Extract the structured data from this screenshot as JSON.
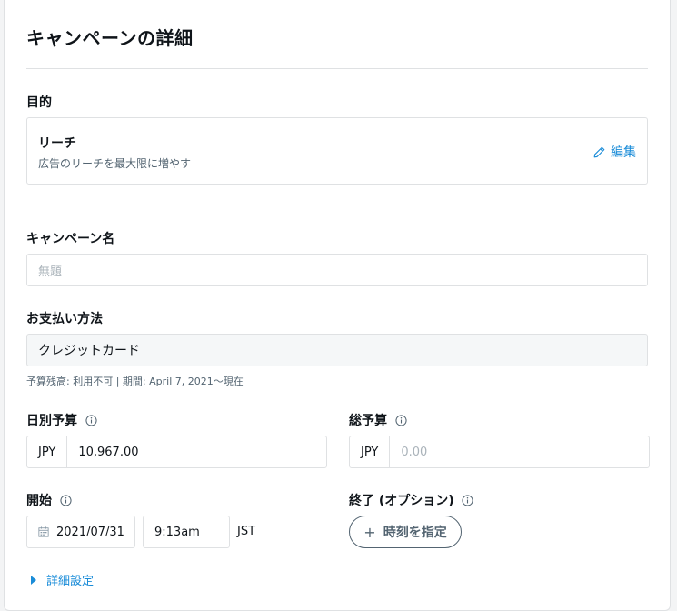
{
  "page": {
    "title": "キャンペーンの詳細"
  },
  "objective": {
    "label": "目的",
    "name": "リーチ",
    "description": "広告のリーチを最大限に増やす",
    "edit_label": "編集"
  },
  "campaign_name": {
    "label": "キャンペーン名",
    "placeholder": "無題",
    "value": ""
  },
  "payment": {
    "label": "お支払い方法",
    "value": "クレジットカード",
    "help": "予算残高: 利用不可 | 期間: April 7, 2021〜現在"
  },
  "daily_budget": {
    "label": "日別予算",
    "currency": "JPY",
    "value": "10,967.00"
  },
  "total_budget": {
    "label": "総予算",
    "currency": "JPY",
    "placeholder": "0.00"
  },
  "start": {
    "label": "開始",
    "date": "2021/07/31",
    "time": "9:13am",
    "timezone": "JST"
  },
  "end": {
    "label": "終了 (オプション)",
    "button_label": "時刻を指定",
    "button_prefix": "+"
  },
  "advanced": {
    "label": "詳細設定"
  },
  "colors": {
    "accent": "#1a8cd8",
    "text": "#0f1419",
    "muted": "#536471",
    "border": "#dfe1e3"
  }
}
